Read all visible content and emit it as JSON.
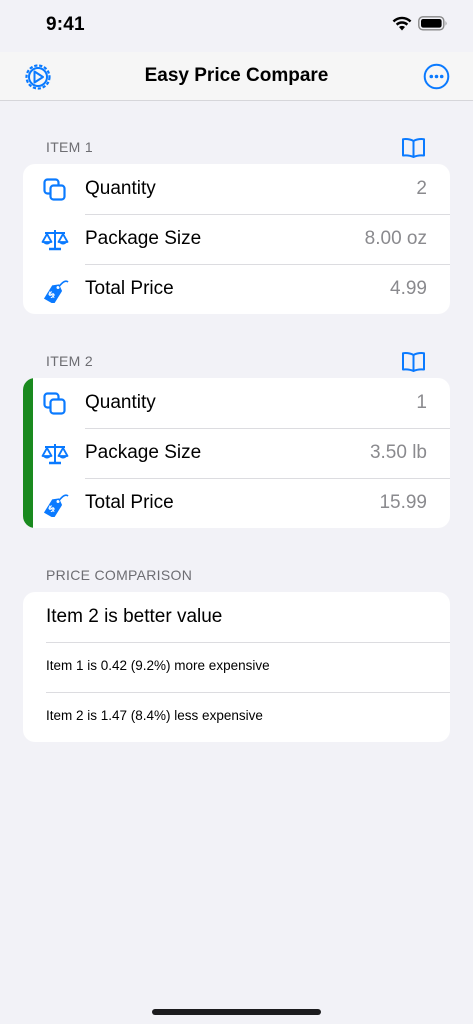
{
  "status_bar": {
    "time": "9:41"
  },
  "nav": {
    "title": "Easy Price Compare"
  },
  "item1": {
    "header": "ITEM 1",
    "rows": [
      {
        "icon": "copy-icon",
        "label": "Quantity",
        "value": "2"
      },
      {
        "icon": "scale-icon",
        "label": "Package Size",
        "value": "8.00 oz"
      },
      {
        "icon": "price-tag-icon",
        "label": "Total Price",
        "value": "4.99"
      }
    ]
  },
  "item2": {
    "header": "ITEM 2",
    "rows": [
      {
        "icon": "copy-icon",
        "label": "Quantity",
        "value": "1"
      },
      {
        "icon": "scale-icon",
        "label": "Package Size",
        "value": "3.50 lb"
      },
      {
        "icon": "price-tag-icon",
        "label": "Total Price",
        "value": "15.99"
      }
    ]
  },
  "comparison": {
    "header": "PRICE COMPARISON",
    "result": "Item 2 is better value",
    "line1": "Item 1 is 0.42 (9.2%) more expensive",
    "line2": "Item 2 is 1.47 (8.4%) less expensive"
  },
  "colors": {
    "accent": "#0a7aff",
    "selected_bar": "#1a8a1f",
    "background": "#f2f2f7"
  }
}
